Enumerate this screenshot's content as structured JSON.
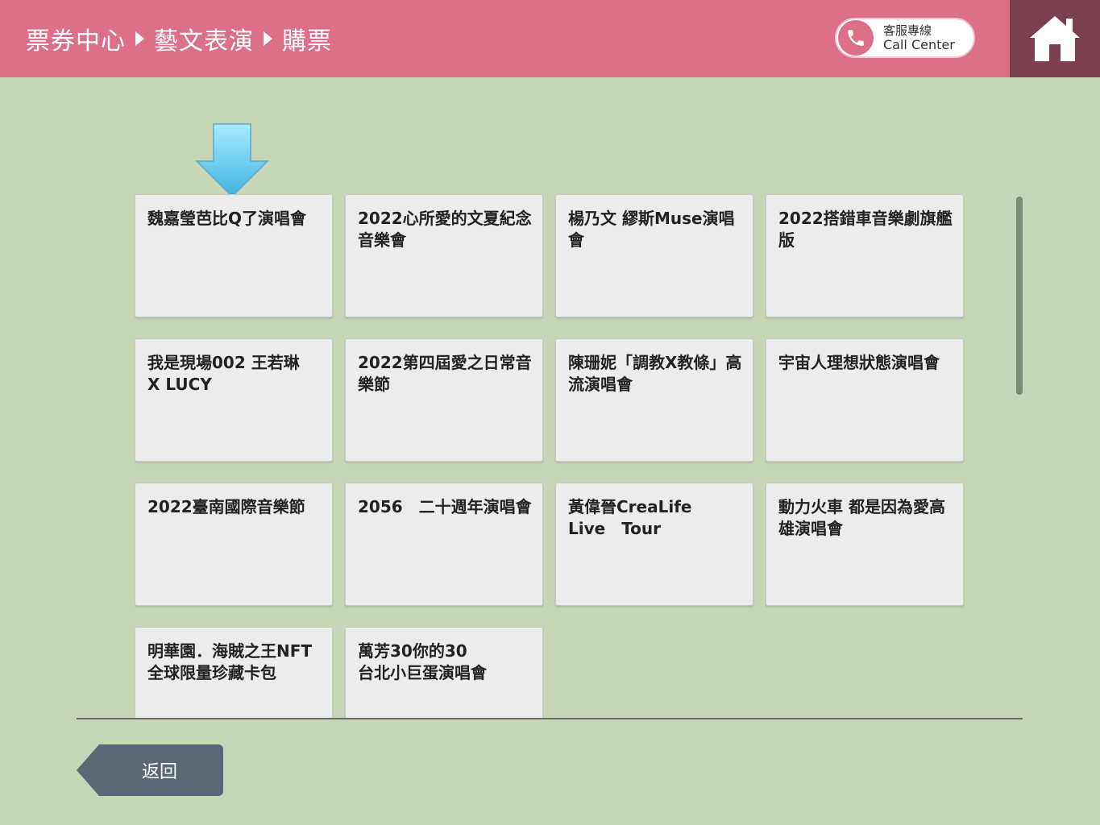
{
  "header": {
    "breadcrumb": [
      "票券中心",
      "藝文表演",
      "購票"
    ],
    "call_center_zh": "客服專線",
    "call_center_en": "Call Center"
  },
  "events": [
    {
      "label": "魏嘉瑩芭比Q了演唱會"
    },
    {
      "label": "2022心所愛的文夏紀念音樂會"
    },
    {
      "label": "楊乃文 繆斯Muse演唱會"
    },
    {
      "label": "2022搭錯車音樂劇旗艦版"
    },
    {
      "label": "我是現場002 王若琳\nX LUCY"
    },
    {
      "label": "2022第四屆愛之日常音樂節"
    },
    {
      "label": "陳珊妮「調教X教條」高流演唱會"
    },
    {
      "label": "宇宙人理想狀態演唱會"
    },
    {
      "label": "2022臺南國際音樂節"
    },
    {
      "label": "2056　二十週年演唱會"
    },
    {
      "label": "黃偉晉CreaLife\nLive　Tour"
    },
    {
      "label": "動力火車 都是因為愛高雄演唱會"
    },
    {
      "label": "明華園．海賊之王NFT全球限量珍藏卡包"
    },
    {
      "label": "萬芳30你的30\n台北小巨蛋演唱會"
    }
  ],
  "footer": {
    "back_label": "返回"
  },
  "colors": {
    "header": "#db7088",
    "home": "#7b3f4f",
    "background": "#c6d6b6",
    "card": "#ececec",
    "back_button": "#5b6775",
    "arrow": "#5cc8ec"
  }
}
